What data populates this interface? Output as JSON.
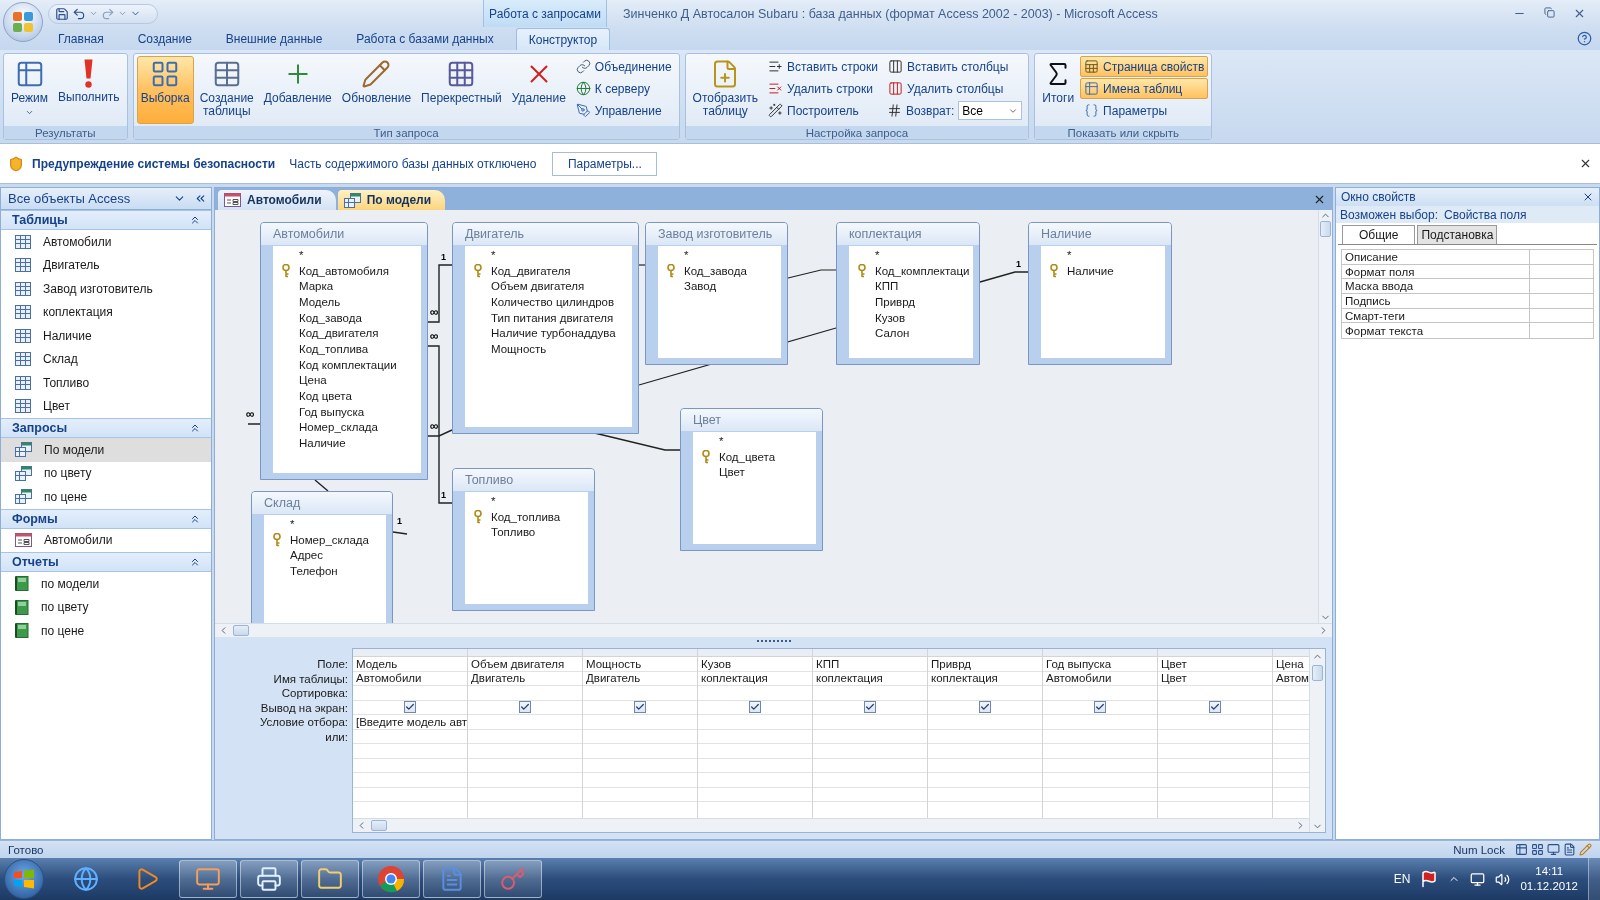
{
  "window": {
    "title": "Зинченко Д Автосалон Subaru : база данных (формат Access 2002 - 2003)  -  Microsoft Access",
    "context_tab": "Работа с запросами"
  },
  "ribbon_tabs": [
    {
      "label": "Главная",
      "selected": false
    },
    {
      "label": "Создание",
      "selected": false
    },
    {
      "label": "Внешние данные",
      "selected": false
    },
    {
      "label": "Работа с базами данных",
      "selected": false
    },
    {
      "label": "Конструктор",
      "selected": true
    }
  ],
  "ribbon_groups": [
    {
      "title": "Результаты",
      "items": [
        {
          "kind": "large",
          "label": "Режим",
          "selected": false,
          "dropdown": true
        },
        {
          "kind": "large",
          "label": "Выполнить",
          "selected": false,
          "dropdown": false
        }
      ]
    },
    {
      "title": "Тип запроса",
      "items": [
        {
          "kind": "large",
          "label": "Выборка",
          "selected": true,
          "dropdown": false
        },
        {
          "kind": "large",
          "label": "Создание\nтаблицы",
          "selected": false,
          "dropdown": false
        },
        {
          "kind": "large",
          "label": "Добавление",
          "selected": false,
          "dropdown": false
        },
        {
          "kind": "large",
          "label": "Обновление",
          "selected": false,
          "dropdown": false
        },
        {
          "kind": "large",
          "label": "Перекрестный",
          "selected": false,
          "dropdown": false
        },
        {
          "kind": "large",
          "label": "Удаление",
          "selected": false,
          "dropdown": false
        },
        {
          "kind": "stack",
          "items": [
            {
              "kind": "small",
              "label": "Объединение",
              "selected": false
            },
            {
              "kind": "small",
              "label": "К серверу",
              "selected": false
            },
            {
              "kind": "small",
              "label": "Управление",
              "selected": false
            }
          ]
        }
      ]
    },
    {
      "title": "Настройка запроса",
      "items": [
        {
          "kind": "large",
          "label": "Отобразить\nтаблицу",
          "selected": false,
          "dropdown": false
        },
        {
          "kind": "stack",
          "items": [
            {
              "kind": "small",
              "label": "Вставить строки",
              "selected": false
            },
            {
              "kind": "small",
              "label": "Удалить строки",
              "selected": false
            },
            {
              "kind": "small",
              "label": "Построитель",
              "selected": false
            }
          ]
        },
        {
          "kind": "stack",
          "items": [
            {
              "kind": "small",
              "label": "Вставить столбцы",
              "selected": false
            },
            {
              "kind": "small",
              "label": "Удалить столбцы",
              "selected": false
            },
            {
              "kind": "combo",
              "label": "Возврат:",
              "value": "Все"
            }
          ]
        }
      ]
    },
    {
      "title": "Показать или скрыть",
      "items": [
        {
          "kind": "large",
          "label": "Итоги",
          "selected": false,
          "dropdown": false
        },
        {
          "kind": "stack",
          "items": [
            {
              "kind": "small",
              "label": "Страница свойств",
              "selected": true
            },
            {
              "kind": "small",
              "label": "Имена таблиц",
              "selected": true
            },
            {
              "kind": "small",
              "label": "Параметры",
              "selected": false
            }
          ]
        }
      ]
    }
  ],
  "security_bar": {
    "title": "Предупреждение системы безопасности",
    "message": "Часть содержимого базы данных отключено",
    "button": "Параметры..."
  },
  "nav": {
    "header": "Все объекты Access",
    "groups": [
      {
        "title": "Таблицы",
        "kind": "tables",
        "expanded": true,
        "items": [
          {
            "label": "Автомобили",
            "selected": false
          },
          {
            "label": "Двигатель",
            "selected": false
          },
          {
            "label": "Завод изготовитель",
            "selected": false
          },
          {
            "label": "коплектация",
            "selected": false
          },
          {
            "label": "Наличие",
            "selected": false
          },
          {
            "label": "Склад",
            "selected": false
          },
          {
            "label": "Топливо",
            "selected": false
          },
          {
            "label": "Цвет",
            "selected": false
          }
        ]
      },
      {
        "title": "Запросы",
        "kind": "queries",
        "expanded": true,
        "items": [
          {
            "label": "По модели",
            "selected": true
          },
          {
            "label": "по цвету",
            "selected": false
          },
          {
            "label": "по цене",
            "selected": false
          }
        ]
      },
      {
        "title": "Формы",
        "kind": "forms",
        "expanded": true,
        "items": [
          {
            "label": "Автомобили",
            "selected": false
          }
        ]
      },
      {
        "title": "Отчеты",
        "kind": "reports",
        "expanded": true,
        "items": [
          {
            "label": "по модели",
            "selected": false
          },
          {
            "label": "по цвету",
            "selected": false
          },
          {
            "label": "по цене",
            "selected": false
          }
        ]
      }
    ]
  },
  "document_tabs": [
    {
      "label": "Автомобили",
      "kind": "form",
      "selected": false
    },
    {
      "label": "По модели",
      "kind": "query",
      "selected": true
    }
  ],
  "diagram": {
    "tables": [
      {
        "title": "Автомобили",
        "fields": [
          {
            "name": "*",
            "key": false
          },
          {
            "name": "Код_автомобиля",
            "key": true
          },
          {
            "name": "Марка",
            "key": false
          },
          {
            "name": "Модель",
            "key": false
          },
          {
            "name": "Код_завода",
            "key": false
          },
          {
            "name": "Код_двигателя",
            "key": false
          },
          {
            "name": "Код_топлива",
            "key": false
          },
          {
            "name": "Код комплектации",
            "key": false
          },
          {
            "name": "Цена",
            "key": false
          },
          {
            "name": "Код цвета",
            "key": false
          },
          {
            "name": "Год выпуска",
            "key": false
          },
          {
            "name": "Номер_склада",
            "key": false
          },
          {
            "name": "Наличие",
            "key": false
          }
        ]
      },
      {
        "title": "Двигатель",
        "fields": [
          {
            "name": "*",
            "key": false
          },
          {
            "name": "Код_двигателя",
            "key": true
          },
          {
            "name": "Объем двигателя",
            "key": false
          },
          {
            "name": "Количество цилиндров",
            "key": false
          },
          {
            "name": "Тип питания двигателя",
            "key": false
          },
          {
            "name": "Наличие турбонаддува",
            "key": false
          },
          {
            "name": "Мощность",
            "key": false
          }
        ]
      },
      {
        "title": "Завод изготовитель",
        "fields": [
          {
            "name": "*",
            "key": false
          },
          {
            "name": "Код_завода",
            "key": true
          },
          {
            "name": "Завод",
            "key": false
          }
        ]
      },
      {
        "title": "коплектация",
        "fields": [
          {
            "name": "*",
            "key": false
          },
          {
            "name": "Код_комплектаци",
            "key": true
          },
          {
            "name": "КПП",
            "key": false
          },
          {
            "name": "Приврд",
            "key": false
          },
          {
            "name": "Кузов",
            "key": false
          },
          {
            "name": "Салон",
            "key": false
          }
        ]
      },
      {
        "title": "Наличие",
        "fields": [
          {
            "name": "*",
            "key": false
          },
          {
            "name": "Наличие",
            "key": true
          }
        ]
      },
      {
        "title": "Цвет",
        "fields": [
          {
            "name": "*",
            "key": false
          },
          {
            "name": "Код_цвета",
            "key": true
          },
          {
            "name": "Цвет",
            "key": false
          }
        ]
      },
      {
        "title": "Склад",
        "fields": [
          {
            "name": "*",
            "key": false
          },
          {
            "name": "Номер_склада",
            "key": true
          },
          {
            "name": "Адрес",
            "key": false
          },
          {
            "name": "Телефон",
            "key": false
          }
        ]
      },
      {
        "title": "Топливо",
        "fields": [
          {
            "name": "*",
            "key": false
          },
          {
            "name": "Код_топлива",
            "key": true
          },
          {
            "name": "Топливо",
            "key": false
          }
        ]
      }
    ],
    "relations": [
      {
        "many": "∞",
        "one": "1"
      },
      {
        "many": "∞",
        "one": "1"
      },
      {
        "many": "∞",
        "one": "1"
      },
      {
        "one": "1"
      },
      {
        "many": "∞"
      }
    ]
  },
  "query_grid": {
    "row_labels": [
      "Поле:",
      "Имя таблицы:",
      "Сортировка:",
      "Вывод на экран:",
      "Условие отбора:",
      "или:"
    ],
    "columns": [
      {
        "field": "Модель",
        "table": "Автомобили",
        "show": true,
        "criteria": "[Введите модель авт"
      },
      {
        "field": "Объем двигателя",
        "table": "Двигатель",
        "show": true
      },
      {
        "field": "Мощность",
        "table": "Двигатель",
        "show": true
      },
      {
        "field": "Кузов",
        "table": "коплектация",
        "show": true
      },
      {
        "field": "КПП",
        "table": "коплектация",
        "show": true
      },
      {
        "field": "Приврд",
        "table": "коплектация",
        "show": true
      },
      {
        "field": "Год выпуска",
        "table": "Автомобили",
        "show": true
      },
      {
        "field": "Цвет",
        "table": "Цвет",
        "show": true
      },
      {
        "field": "Цена",
        "table": "Автом"
      }
    ]
  },
  "property_sheet": {
    "title": "Окно свойств",
    "selection_label": "Возможен выбор:",
    "selection_value": "Свойства поля",
    "tabs": [
      {
        "label": "Общие",
        "selected": true
      },
      {
        "label": "Подстановка",
        "selected": false
      }
    ],
    "properties": [
      {
        "name": "Описание"
      },
      {
        "name": "Формат поля"
      },
      {
        "name": "Маска ввода"
      },
      {
        "name": "Подпись"
      },
      {
        "name": "Смарт-теги"
      },
      {
        "name": "Формат текста"
      }
    ]
  },
  "status_bar": {
    "text": "Готово",
    "indicator": "Num Lock"
  },
  "taskbar": {
    "apps": [
      {
        "running": false
      },
      {
        "running": false
      },
      {
        "running": true
      },
      {
        "running": true
      },
      {
        "running": true
      },
      {
        "running": true
      },
      {
        "running": true
      },
      {
        "running": true
      }
    ],
    "language": "EN",
    "time": "14:11",
    "date": "01.12.2012"
  }
}
